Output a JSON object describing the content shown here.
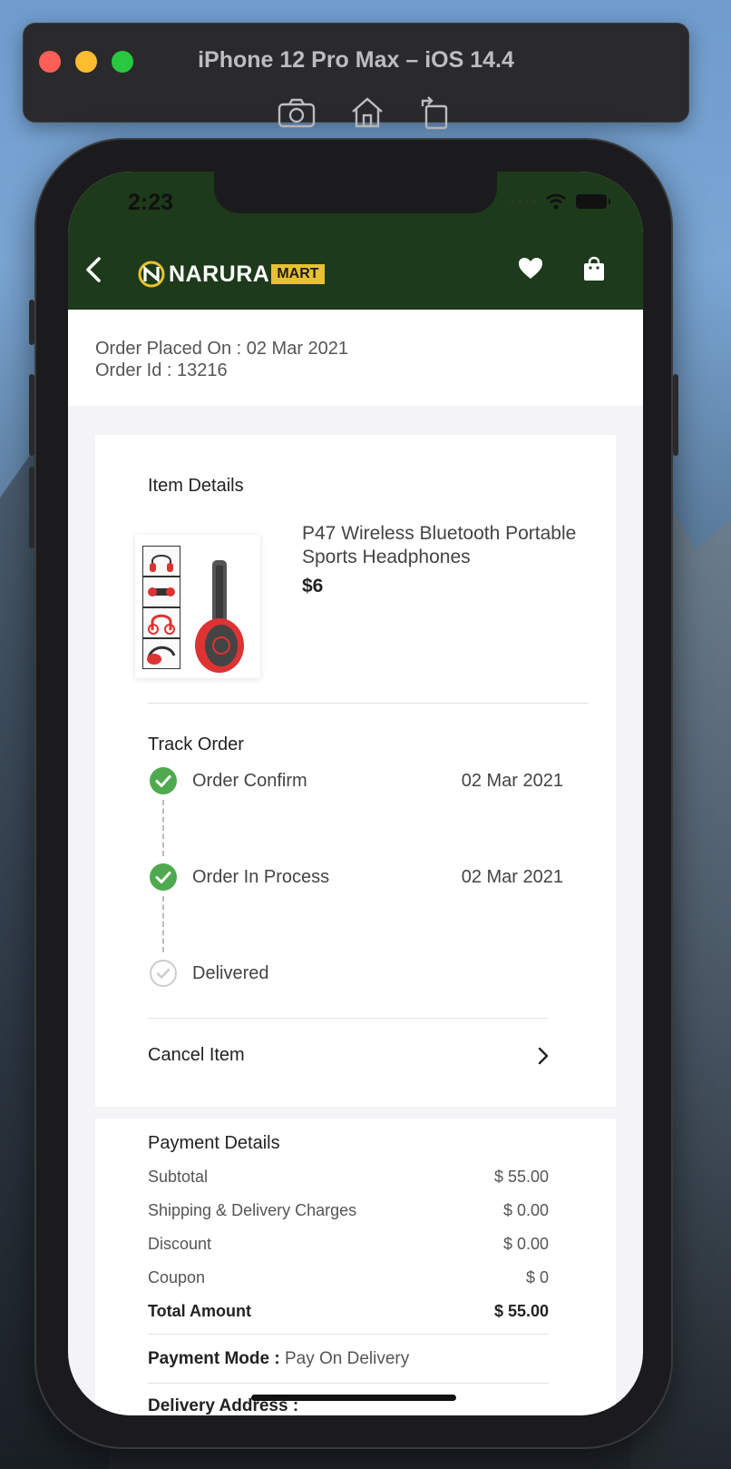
{
  "simulator": {
    "title": "iPhone 12 Pro Max – iOS 14.4",
    "icons": [
      "camera-icon",
      "home-icon",
      "rotate-icon"
    ]
  },
  "status_bar": {
    "time": "2:23"
  },
  "header": {
    "brand": "NARURA",
    "brand_tag": "MART",
    "icons": [
      "back-chevron-icon",
      "heart-icon",
      "shopping-bag-icon"
    ],
    "colors": {
      "background": "#1d3a1b",
      "accent": "#e8c130"
    }
  },
  "order": {
    "placed_on": "Order Placed On : 02 Mar 2021",
    "order_id": "Order Id : 13216"
  },
  "item_details": {
    "title": "Item Details",
    "product_name": "P47 Wireless Bluetooth Portable Sports Headphones",
    "price": "$6"
  },
  "track_order": {
    "title": "Track Order",
    "steps": [
      {
        "label": "Order Confirm",
        "date": "02 Mar 2021",
        "status": "done"
      },
      {
        "label": "Order In Process",
        "date": "02 Mar 2021",
        "status": "done"
      },
      {
        "label": "Delivered",
        "date": "",
        "status": "pending"
      }
    ],
    "colors": {
      "done": "#4faa4f",
      "pending": "#cccccc"
    }
  },
  "cancel": {
    "label": "Cancel Item"
  },
  "payment": {
    "title": "Payment Details",
    "rows": [
      {
        "label": "Subtotal",
        "value": "$ 55.00"
      },
      {
        "label": "Shipping & Delivery Charges",
        "value": "$ 0.00"
      },
      {
        "label": "Discount",
        "value": "$ 0.00"
      },
      {
        "label": "Coupon",
        "value": "$ 0"
      }
    ],
    "total": {
      "label": "Total Amount",
      "value": "$ 55.00"
    },
    "mode_label": "Payment Mode :",
    "mode_value": " Pay On Delivery",
    "delivery_address_label": "Delivery Address :"
  }
}
